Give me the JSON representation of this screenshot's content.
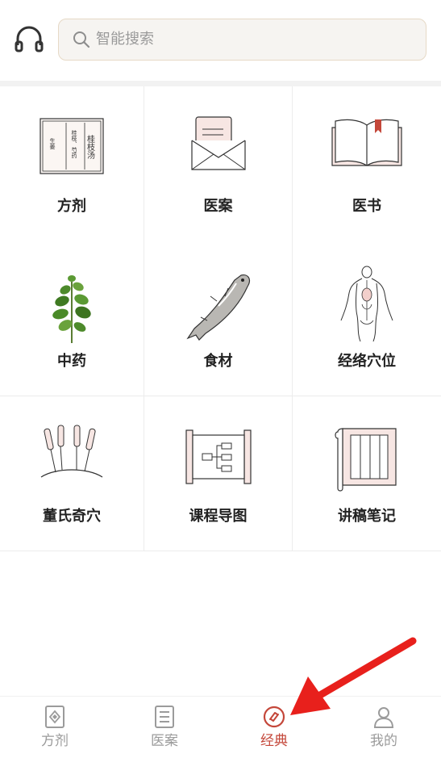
{
  "header": {
    "search_placeholder": "智能搜索",
    "icons": {
      "left": "headphone-icon",
      "search": "search-icon"
    }
  },
  "grid": {
    "items": [
      {
        "label": "方剂",
        "icon": "prescription-book-icon",
        "art_text": [
          "桂枝汤",
          "桂枝、芍药",
          "生姜"
        ]
      },
      {
        "label": "医案",
        "icon": "envelope-icon"
      },
      {
        "label": "医书",
        "icon": "open-book-icon"
      },
      {
        "label": "中药",
        "icon": "herb-icon"
      },
      {
        "label": "食材",
        "icon": "fish-icon"
      },
      {
        "label": "经络穴位",
        "icon": "meridian-body-icon"
      },
      {
        "label": "董氏奇穴",
        "icon": "acupuncture-needles-icon"
      },
      {
        "label": "课程导图",
        "icon": "mindmap-scroll-icon"
      },
      {
        "label": "讲稿笔记",
        "icon": "notes-scroll-icon"
      }
    ]
  },
  "tabbar": {
    "tabs": [
      {
        "label": "方剂",
        "icon": "prescription-tab-icon",
        "active": false
      },
      {
        "label": "医案",
        "icon": "document-tab-icon",
        "active": false
      },
      {
        "label": "经典",
        "icon": "classic-tab-icon",
        "active": true
      },
      {
        "label": "我的",
        "icon": "profile-tab-icon",
        "active": false
      }
    ]
  },
  "colors": {
    "accent": "#c4473a",
    "tab_inactive": "#9b9b9b",
    "annotation_arrow": "#e8201c"
  }
}
